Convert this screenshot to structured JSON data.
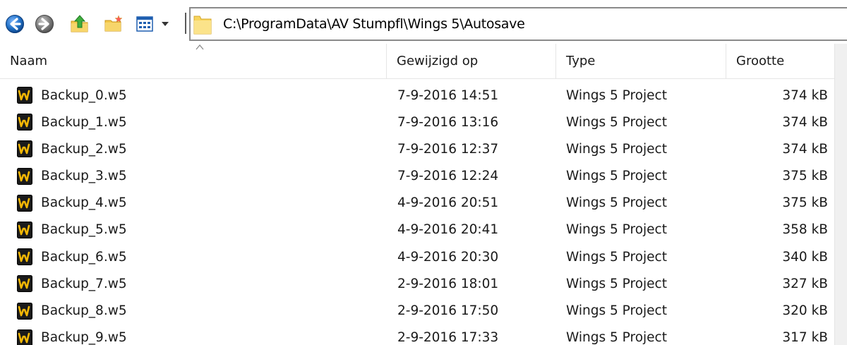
{
  "toolbar": {
    "buttons": [
      {
        "name": "back-button",
        "icon": "arrow-left-icon"
      },
      {
        "name": "forward-button",
        "icon": "arrow-right-icon"
      },
      {
        "name": "up-button",
        "icon": "folder-up-icon"
      },
      {
        "name": "new-folder-button",
        "icon": "new-folder-icon"
      },
      {
        "name": "view-menu-button",
        "icon": "grid-view-icon"
      }
    ],
    "address": "C:\\ProgramData\\AV Stumpfl\\Wings 5\\Autosave"
  },
  "columns": {
    "name": "Naam",
    "modified": "Gewijzigd op",
    "type": "Type",
    "size": "Grootte"
  },
  "files": [
    {
      "name": "Backup_0.w5",
      "modified": "7-9-2016 14:51",
      "type": "Wings 5 Project",
      "size": "374 kB"
    },
    {
      "name": "Backup_1.w5",
      "modified": "7-9-2016 13:16",
      "type": "Wings 5 Project",
      "size": "374 kB"
    },
    {
      "name": "Backup_2.w5",
      "modified": "7-9-2016 12:37",
      "type": "Wings 5 Project",
      "size": "374 kB"
    },
    {
      "name": "Backup_3.w5",
      "modified": "7-9-2016 12:24",
      "type": "Wings 5 Project",
      "size": "375 kB"
    },
    {
      "name": "Backup_4.w5",
      "modified": "4-9-2016 20:51",
      "type": "Wings 5 Project",
      "size": "375 kB"
    },
    {
      "name": "Backup_5.w5",
      "modified": "4-9-2016 20:41",
      "type": "Wings 5 Project",
      "size": "358 kB"
    },
    {
      "name": "Backup_6.w5",
      "modified": "4-9-2016 20:30",
      "type": "Wings 5 Project",
      "size": "340 kB"
    },
    {
      "name": "Backup_7.w5",
      "modified": "2-9-2016 18:01",
      "type": "Wings 5 Project",
      "size": "327 kB"
    },
    {
      "name": "Backup_8.w5",
      "modified": "2-9-2016 17:50",
      "type": "Wings 5 Project",
      "size": "320 kB"
    },
    {
      "name": "Backup_9.w5",
      "modified": "2-9-2016 17:33",
      "type": "Wings 5 Project",
      "size": "317 kB"
    }
  ],
  "colors": {
    "icon_bg": "#1a1a1a",
    "icon_letter": "#f2b705",
    "nav_blue": "#1f6fc4",
    "address_border": "#8a8a8a"
  }
}
